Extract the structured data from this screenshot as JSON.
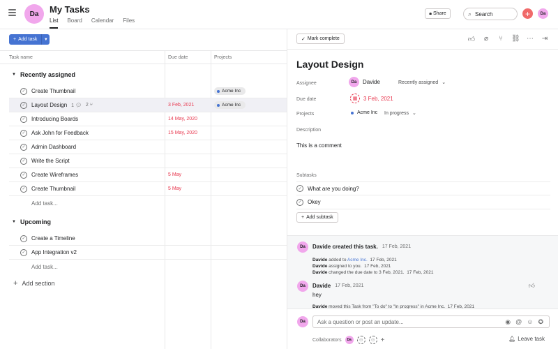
{
  "header": {
    "avatar": "Da",
    "title": "My Tasks",
    "tabs": [
      "List",
      "Board",
      "Calendar",
      "Files"
    ],
    "share_label": "Share",
    "search_placeholder": "Search",
    "user_avatar": "Da",
    "accent_color": "#f06a6a"
  },
  "list": {
    "add_task_label": "Add task",
    "columns": [
      "Task name",
      "Due date",
      "Projects"
    ],
    "sections": [
      {
        "name": "Recently assigned",
        "tasks": [
          {
            "name": "Create Thumbnail",
            "due": "",
            "project": "Acme Inc"
          },
          {
            "name": "Layout Design",
            "comments": "1",
            "subtasks": "2",
            "due": "3 Feb, 2021",
            "project": "Acme Inc"
          },
          {
            "name": "Introducing Boards",
            "due": "14 May, 2020",
            "project": ""
          },
          {
            "name": "Ask John for Feedback",
            "due": "15 May, 2020",
            "project": ""
          },
          {
            "name": "Admin Dashboard",
            "due": "",
            "project": ""
          },
          {
            "name": "Write the Script",
            "due": "",
            "project": ""
          },
          {
            "name": "Create Wireframes",
            "due": "5 May",
            "project": ""
          },
          {
            "name": "Create Thumbnail",
            "due": "5 May",
            "project": ""
          }
        ],
        "add_task": "Add task..."
      },
      {
        "name": "Upcoming",
        "tasks": [
          {
            "name": "Create a Timeline",
            "due": "",
            "project": ""
          },
          {
            "name": "App Integration v2",
            "due": "",
            "project": ""
          }
        ],
        "add_task": "Add task..."
      }
    ],
    "add_section": "Add section"
  },
  "detail": {
    "mark_complete": "Mark complete",
    "title": "Layout Design",
    "assignee_label": "Assignee",
    "assignee_avatar": "Da",
    "assignee_name": "Davide",
    "assignee_section": "Recently assigned",
    "due_label": "Due date",
    "due_value": "3 Feb, 2021",
    "projects_label": "Projects",
    "project_name": "Acme Inc",
    "project_status": "In progress",
    "description_label": "Description",
    "description_text": "This is a comment",
    "subtasks_label": "Subtasks",
    "subtasks": [
      "What are you doing?",
      "Okey"
    ],
    "add_subtask": "Add subtask",
    "activity": {
      "created_avatar": "Da",
      "created_author": "Davide created this task.",
      "created_time": "17 Feb, 2021",
      "line1_author": "Davide",
      "line1_text": "added to",
      "line1_link": "Acme Inc.",
      "line1_time": "17 Feb, 2021",
      "line2_author": "Davide",
      "line2_text": "assigned to you.",
      "line2_time": "17 Feb, 2021",
      "line3_author": "Davide",
      "line3_text": "changed the due date to 3 Feb, 2021.",
      "line3_time": "17 Feb, 2021",
      "comment_avatar": "Da",
      "comment_author": "Davide",
      "comment_time": "17 Feb, 2021",
      "comment_text": "hey",
      "move_author": "Davide",
      "move_text": "moved this Task from \"To do\" to \"In progress\" in Acme Inc.",
      "move_time": "17 Feb, 2021"
    },
    "comment_avatar": "Da",
    "comment_placeholder": "Ask a question or post an update...",
    "collaborators_label": "Collaborators",
    "collaborator_avatar": "Da",
    "leave_task": "Leave task"
  }
}
